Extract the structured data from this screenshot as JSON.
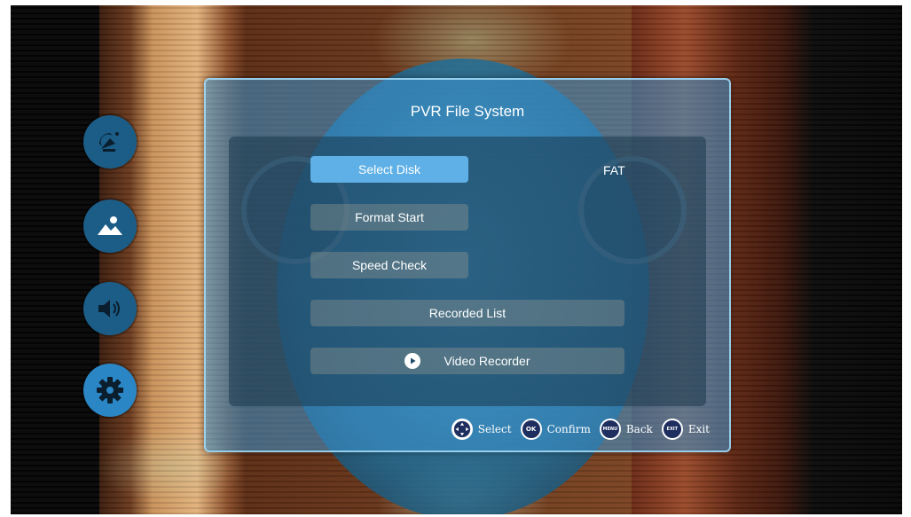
{
  "panel": {
    "title": "PVR File System",
    "select_disk_label": "Select Disk",
    "disk_value": "FAT",
    "format_start_label": "Format Start",
    "speed_check_label": "Speed Check",
    "recorded_list_label": "Recorded List",
    "video_recorder_label": "Video Recorder"
  },
  "side_icons": [
    {
      "icon": "satellite-dish-icon"
    },
    {
      "icon": "picture-icon"
    },
    {
      "icon": "speaker-icon"
    },
    {
      "icon": "gear-icon",
      "active": true
    }
  ],
  "hints": {
    "select_label": "Select",
    "ok_key": "OK",
    "confirm_label": "Confirm",
    "menu_key": "MENU",
    "back_label": "Back",
    "exit_key": "EXIT",
    "exit_label": "Exit"
  },
  "colors": {
    "panel_bg": "#3c96d2",
    "selected_button": "#5fb0e6",
    "side_icon": "#1b5d87"
  }
}
